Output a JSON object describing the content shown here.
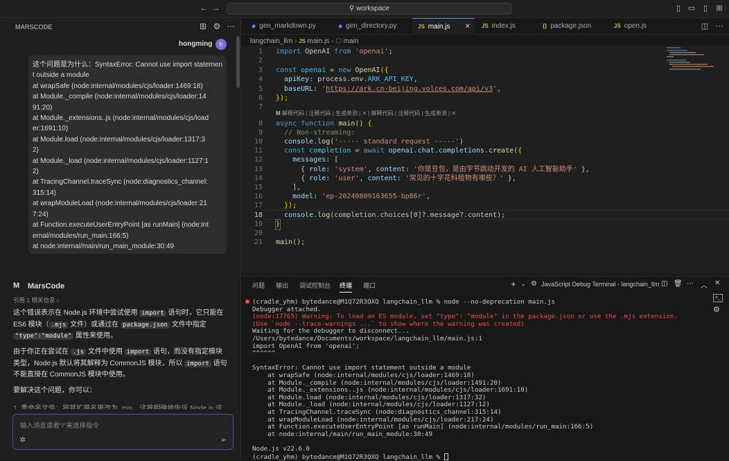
{
  "window": {
    "search_text": "workspace"
  },
  "sidebar": {
    "title": "MARSCODE",
    "username": "hongming",
    "avatar_letter": "h",
    "user_message_lines": [
      "这个问题是为什么：SyntaxError: Cannot use import statemen",
      "t outside a module",
      "    at wrapSafe (node:internal/modules/cjs/loader:1469:18)",
      "    at Module._compile (node:internal/modules/cjs/loader:14",
      "91:20)",
      "    at Module._extensions..js (node:internal/modules/cjs/load",
      "er:1691:10)",
      "    at Module.load (node:internal/modules/cjs/loader:1317:3",
      "2)",
      "    at Module._load (node:internal/modules/cjs/loader:1127:1",
      "2)",
      "    at TracingChannel.traceSync (node:diagnostics_channel:",
      "315:14)",
      "    at wrapModuleLoad (node:internal/modules/cjs/loader:21",
      "7:24)",
      "    at Function.executeUserEntryPoint [as runMain] (node:int",
      "ernal/modules/run_main:166:5)",
      "    at node:internal/main/run_main_module:30:49"
    ],
    "assistant_name": "MarsCode",
    "refs": "引用 1 相关信息 ›",
    "p1": {
      "a": "这个错误表示在 Node.js 环境中尝试使用 ",
      "c1": "import",
      "b": " 语句时，它只能在 ES6 模块（",
      "c2": ".mjs",
      "d": " 文件）或通过在 ",
      "c3": "package.json",
      "e": " 文件中指定 ",
      "c4": "\"type\":\"module\"",
      "f": " 属性来使用。"
    },
    "p2": {
      "a": "由于你正在尝试在 ",
      "c1": ".js",
      "b": " 文件中使用 ",
      "c2": "import",
      "c": " 语句，而没有指定模块类型，Node.js 默认将其解释为 CommonJS 模块，所以 ",
      "c3": "import",
      "d": " 语句不能直接在 CommonJS 模块中使用。"
    },
    "p3": "要解决这个问题，你可以：",
    "p4_partial": "1. 重命名文件：将其扩展名更改为 .mjs，这将明确地告诉 Node.js 这是",
    "input_placeholder": "输入消息或者\"/\"来选择指令"
  },
  "tabs": [
    {
      "label": "gen_markdown.py",
      "icon": "py",
      "active": false
    },
    {
      "label": "gen_directory.py",
      "icon": "py",
      "active": false
    },
    {
      "label": "main.js",
      "icon": "JS",
      "active": true
    },
    {
      "label": "index.js",
      "icon": "JS",
      "active": false
    },
    {
      "label": "package.json",
      "icon": "{}",
      "active": false
    },
    {
      "label": "open.js",
      "icon": "JS",
      "active": false
    }
  ],
  "breadcrumb": {
    "folder": "langchain_llm",
    "file": "main.js",
    "symbol": "main"
  },
  "codelens": "解释代码 | 注释代码 | 生成单测 | ✕ |  解释代码 | 注释代码 | 生成单测 | ✕",
  "line_numbers": [
    "1",
    "2",
    "3",
    "4",
    "5",
    "6",
    "7",
    "8",
    "9",
    "10",
    "11",
    "12",
    "13",
    "14",
    "15",
    "16",
    "17",
    "18",
    "19",
    "20",
    "21"
  ],
  "code": {
    "l1": {
      "kw": "import",
      "id": " OpenAI ",
      "from": "from",
      "s": " 'openai'",
      "e": ";"
    },
    "l3": {
      "kw": "const",
      "v": " openai",
      "eq": " = ",
      "kw2": "new",
      "fn": " OpenAI",
      "p": "({"
    },
    "l4": {
      "k": "  apiKey",
      "c": ": process.env.",
      "v": "ARK_API_KEY",
      "e": ","
    },
    "l5": {
      "k": "  baseURL",
      "c": ": ",
      "s": "'",
      "u": "https://ark.cn-beijing.volces.com/api/v3",
      "s2": "'",
      "e": ","
    },
    "l6": {
      "t": "});"
    },
    "l9": {
      "kw": "async function",
      "fn": " main",
      "p": "() {"
    },
    "l10": {
      "t": "  // Non-streaming:"
    },
    "l11": {
      "a": "  console.",
      "fn": "log",
      "p": "(",
      "s": "'----- standard request -----'",
      "e": ")"
    },
    "l12": {
      "kw": "  const",
      "v": " completion",
      "eq": " = ",
      "kw2": "await",
      "a": " openai.chat.completions.",
      "fn": "create",
      "p": "({"
    },
    "l13": {
      "k": "    messages",
      "e": ": ["
    },
    "l14": {
      "a": "      { ",
      "k": "role",
      "c": ": ",
      "s": "'system'",
      "c2": ", ",
      "k2": "content",
      "c3": ": ",
      "s2": "'你是豆包，是由字节跳动开发的 AI 人工智能助手'",
      "e": " },"
    },
    "l15": {
      "a": "      { ",
      "k": "role",
      "c": ": ",
      "s": "'user'",
      "c2": ", ",
      "k2": "content",
      "c3": ": ",
      "s2": "'常见的十字花科植物有哪些？'",
      "e": " },"
    },
    "l16": {
      "t": "    ],"
    },
    "l17": {
      "k": "    model",
      "c": ": ",
      "s": "'ep-20240809163655-bp86r'",
      "e": ","
    },
    "l18": {
      "t": "  });"
    },
    "l19": {
      "a": "  console.",
      "fn": "log",
      "p": "(completion.choices[",
      "n": "0",
      "e": "]?.message?.content);"
    },
    "l20": {
      "t": "}"
    },
    "l22": {
      "fn": "main",
      "e": "();"
    }
  },
  "panel": {
    "tabs": [
      "问题",
      "输出",
      "调试控制台",
      "终端",
      "端口"
    ],
    "active_tab": "终端",
    "terminal_title": "JavaScript Debug Terminal - langchain_llm"
  },
  "terminal": [
    {
      "cls": "",
      "t": "(cradle_yhm) bytedance@M1Q72R3QXQ langchain_llm % node --no-deprecation main.js"
    },
    {
      "cls": "",
      "t": "Debugger attached."
    },
    {
      "cls": "tred",
      "t": "(node:17765) Warning: To load an ES module, set \"type\": \"module\" in the package.json or use the .mjs extension."
    },
    {
      "cls": "tred",
      "t": "(Use `node --trace-warnings ...` to show where the warning was created)"
    },
    {
      "cls": "",
      "t": "Waiting for the debugger to disconnect..."
    },
    {
      "cls": "",
      "t": "/Users/bytedance/Documents/workspace/langchain_llm/main.js:1"
    },
    {
      "cls": "",
      "t": "import OpenAI from 'openai';"
    },
    {
      "cls": "",
      "t": "^^^^^^"
    },
    {
      "cls": "",
      "t": ""
    },
    {
      "cls": "",
      "t": "SyntaxError: Cannot use import statement outside a module"
    },
    {
      "cls": "",
      "t": "    at wrapSafe (node:internal/modules/cjs/loader:1469:18)"
    },
    {
      "cls": "",
      "t": "    at Module._compile (node:internal/modules/cjs/loader:1491:20)"
    },
    {
      "cls": "",
      "t": "    at Module._extensions..js (node:internal/modules/cjs/loader:1691:10)"
    },
    {
      "cls": "",
      "t": "    at Module.load (node:internal/modules/cjs/loader:1317:32)"
    },
    {
      "cls": "",
      "t": "    at Module._load (node:internal/modules/cjs/loader:1127:12)"
    },
    {
      "cls": "",
      "t": "    at TracingChannel.traceSync (node:diagnostics_channel:315:14)"
    },
    {
      "cls": "",
      "t": "    at wrapModuleLoad (node:internal/modules/cjs/loader:217:24)"
    },
    {
      "cls": "",
      "t": "    at Function.executeUserEntryPoint [as runMain] (node:internal/modules/run_main:166:5)"
    },
    {
      "cls": "",
      "t": "    at node:internal/main/run_main_module:30:49"
    },
    {
      "cls": "",
      "t": ""
    },
    {
      "cls": "",
      "t": "Node.js v22.6.0"
    },
    {
      "cls": "",
      "t": "(cradle_yhm) bytedance@M1Q72R3QXQ langchain_llm % "
    }
  ]
}
